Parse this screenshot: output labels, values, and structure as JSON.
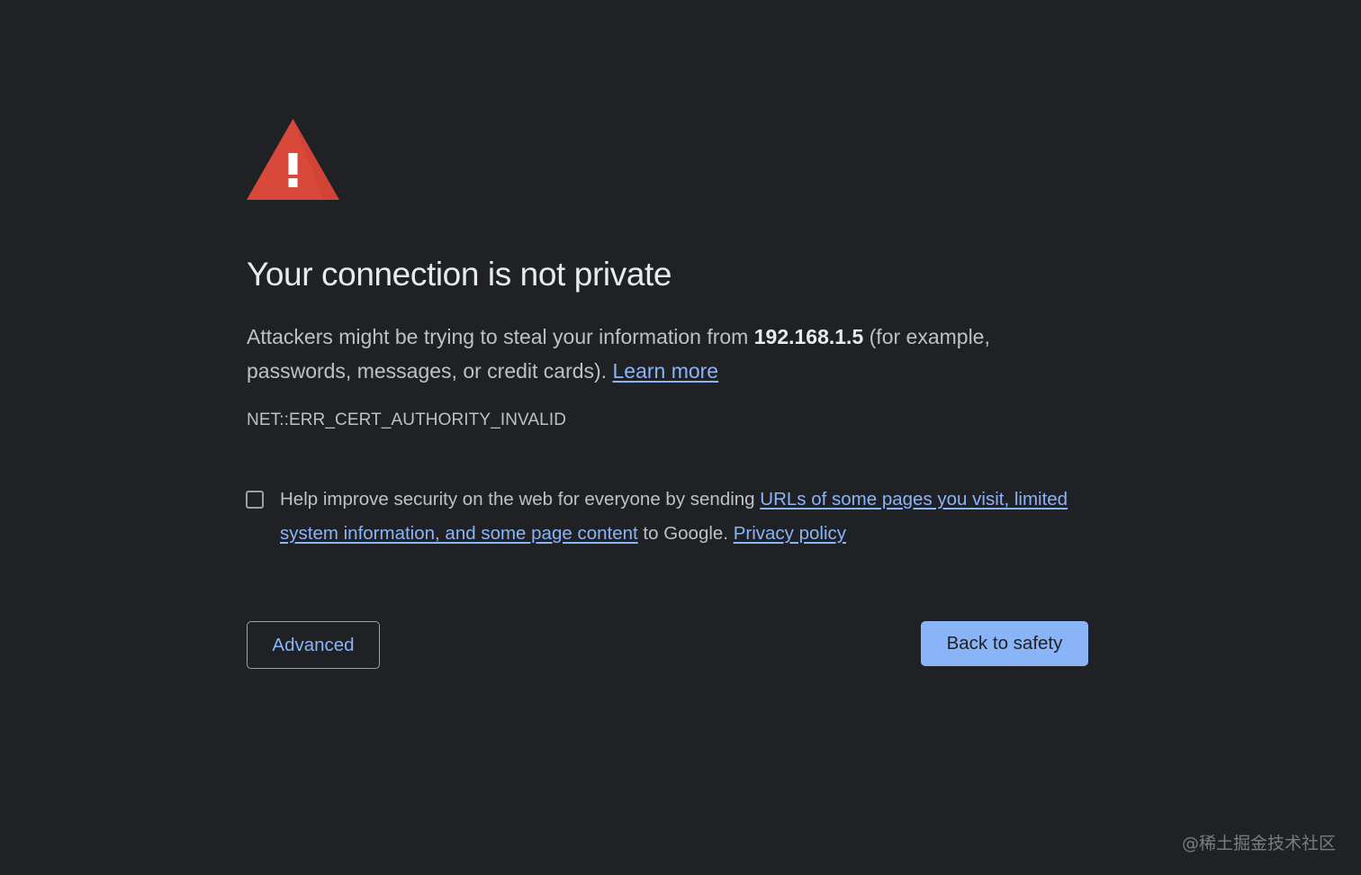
{
  "icon": "warning-triangle-icon",
  "colors": {
    "background": "#202124",
    "warning_red": "#d9493b",
    "link": "#8ab4f8",
    "primary_button": "#8ab4f8"
  },
  "title": "Your connection is not private",
  "explanation": {
    "prefix": "Attackers might be trying to steal your information from ",
    "host": "192.168.1.5",
    "suffix": " (for example, passwords, messages, or credit cards). ",
    "learn_more": "Learn more"
  },
  "error_code": "NET::ERR_CERT_AUTHORITY_INVALID",
  "optin": {
    "checked": false,
    "prefix": "Help improve security on the web for everyone by sending ",
    "link_text": "URLs of some pages you visit, limited system information, and some page content",
    "middle": " to Google. ",
    "privacy_link": "Privacy policy"
  },
  "buttons": {
    "advanced": "Advanced",
    "back_to_safety": "Back to safety"
  },
  "watermark": "@稀土掘金技术社区"
}
